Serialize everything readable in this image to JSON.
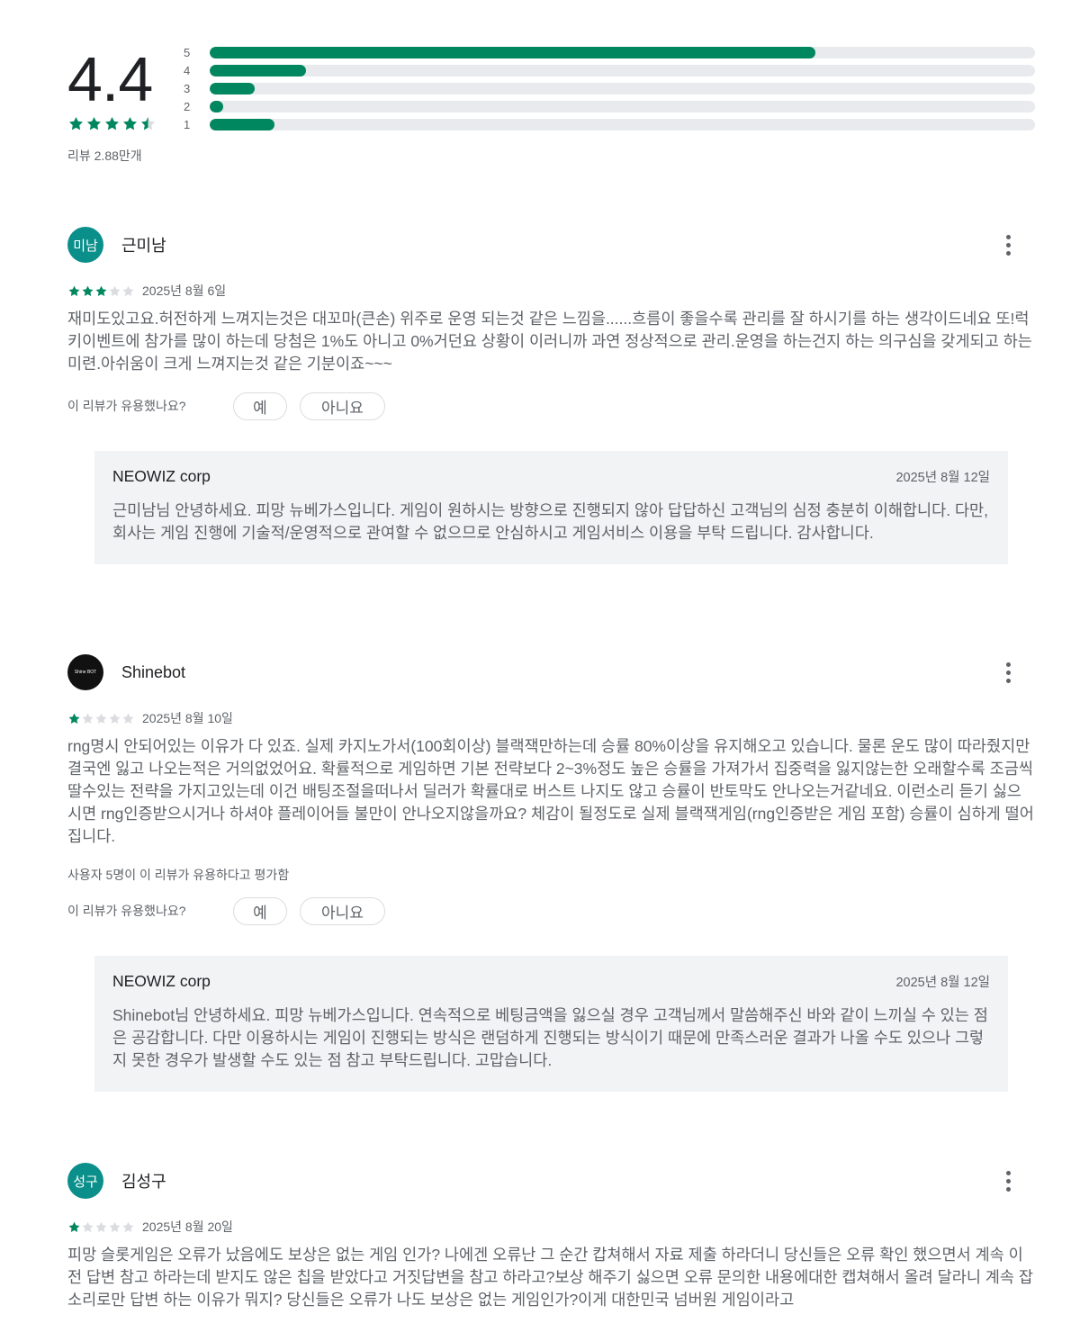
{
  "summary": {
    "score": "4.4",
    "rating": 4.4,
    "review_count": "리뷰 2.88만개",
    "distribution": [
      {
        "label": "5",
        "fraction": 0.734
      },
      {
        "label": "4",
        "fraction": 0.117
      },
      {
        "label": "3",
        "fraction": 0.055
      },
      {
        "label": "2",
        "fraction": 0.016
      },
      {
        "label": "1",
        "fraction": 0.079
      }
    ]
  },
  "colors": {
    "accent": "#01875f",
    "star_empty": "#dadce0",
    "avatar_teal": "#0a8f8a"
  },
  "helpful_question": "이 리뷰가 유용했나요?",
  "yes_label": "예",
  "no_label": "아니요",
  "reviews": [
    {
      "avatar_text": "미남",
      "name": "근미남",
      "stars": 3,
      "date": "2025년 8월 6일",
      "text": "재미도있고요.허전하게 느껴지는것은 대꼬마(큰손) 위주로 운영 되는것 같은 느낌을......흐름이 좋을수록 관리를 잘 하시기를 하는 생각이드네요 또!럭키이벤트에 참가를 많이 하는데 당첨은 1%도 아니고 0%거던요 상황이 이러니까 과연 정상적으로 관리.운영을 하는건지 하는 의구심을 갖게되고 하는 미련.아쉬움이 크게 느껴지는것 같은 기분이죠~~~",
      "helpful_count": "",
      "reply": {
        "name": "NEOWIZ corp",
        "date": "2025년 8월 12일",
        "text": "근미남님 안녕하세요. 피망 뉴베가스입니다. 게임이 원하시는 방향으로 진행되지 않아 답답하신 고객님의 심정 충분히 이해합니다. 다만, 회사는 게임 진행에 기술적/운영적으로 관여할 수 없으므로 안심하시고 게임서비스 이용을 부탁 드립니다. 감사합니다."
      }
    },
    {
      "avatar_text": "Shine BOT",
      "name": "Shinebot",
      "stars": 1,
      "date": "2025년 8월 10일",
      "text": "rng명시 안되어있는 이유가 다 있죠. 실제 카지노가서(100회이상) 블랙잭만하는데 승률 80%이상을 유지해오고 있습니다. 물론 운도 많이 따라줬지만 결국엔 잃고 나오는적은 거의없었어요. 확률적으로 게임하면 기본 전략보다 2~3%정도 높은 승률을 가져가서 집중력을 잃지않는한 오래할수록 조금씩 딸수있는 전략을 가지고있는데 이건 배팅조절을떠나서 딜러가 확률대로 버스트 나지도 않고 승률이 반토막도 안나오는거같네요. 이런소리 듣기 싫으시면 rng인증받으시거나 하셔야 플레이어들 불만이 안나오지않을까요? 체감이 될정도로 실제 블랙잭게임(rng인증받은 게임 포함) 승률이 심하게 떨어집니다.",
      "helpful_count": "사용자 5명이 이 리뷰가 유용하다고 평가함",
      "reply": {
        "name": "NEOWIZ corp",
        "date": "2025년 8월 12일",
        "text": "Shinebot님 안녕하세요. 피망 뉴베가스입니다. 연속적으로 베팅금액을 잃으실 경우 고객님께서 말씀해주신 바와 같이 느끼실 수 있는 점은 공감합니다. 다만 이용하시는 게임이 진행되는 방식은 랜덤하게 진행되는 방식이기 때문에 만족스러운 결과가 나올 수도 있으나 그렇지 못한 경우가 발생할 수도 있는 점 참고 부탁드립니다. 고맙습니다."
      }
    },
    {
      "avatar_text": "성구",
      "name": "김성구",
      "stars": 1,
      "date": "2025년 8월 20일",
      "text": "피망 슬롯게임은 오류가 났음에도 보상은 없는 게임 인가? 나에겐 오류난 그 순간 캅쳐해서 자료 제출 하라더니 당신들은 오류 확인 했으면서 계속 이전 답변 참고 하라는데 받지도 않은 칩을 받았다고 거짓답변을 참고 하라고?보상 해주기 싫으면 오류 문의한 내용에대한 캡쳐해서 올려 달라니 계속 잡소리로만 답변 하는 이유가 뭐지? 당신들은 오류가 나도 보상은 없는 게임인가?이게 대한민국 넘버원 게임이라고",
      "helpful_count": "",
      "reply": null
    }
  ]
}
